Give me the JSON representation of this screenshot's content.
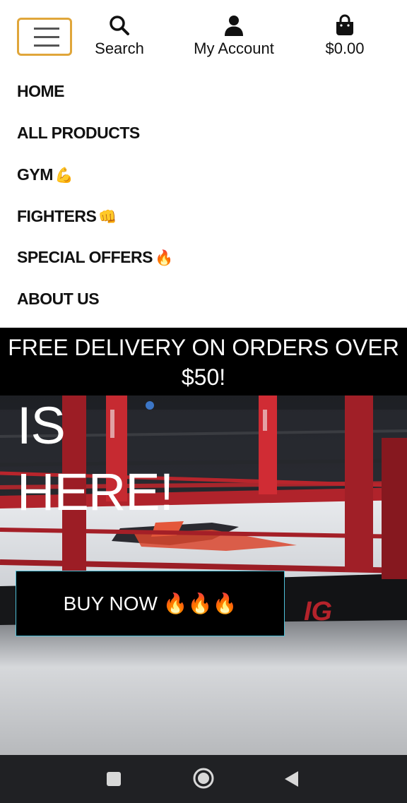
{
  "header": {
    "menu_icon": "hamburger-menu-icon",
    "search": {
      "label": "Search",
      "icon": "search-icon"
    },
    "account": {
      "label": "My Account",
      "icon": "user-icon"
    },
    "cart": {
      "label": "$0.00",
      "icon": "shopping-bag-icon"
    }
  },
  "nav": {
    "items": [
      {
        "label": "HOME",
        "emoji": ""
      },
      {
        "label": "ALL PRODUCTS",
        "emoji": ""
      },
      {
        "label": "GYM",
        "emoji": "💪"
      },
      {
        "label": "FIGHTERS",
        "emoji": "👊"
      },
      {
        "label": "SPECIAL OFFERS",
        "emoji": "🔥"
      },
      {
        "label": "ABOUT US",
        "emoji": ""
      }
    ]
  },
  "banner": {
    "text": "FREE DELIVERY ON ORDERS OVER $50!"
  },
  "hero": {
    "headline": "IS\nHERE!",
    "button_label": "BUY NOW 🔥🔥🔥"
  },
  "system_nav": {
    "buttons": [
      "recents-icon",
      "home-icon",
      "back-icon"
    ]
  },
  "colors": {
    "menu_border": "#e0a63a",
    "banner_bg": "#000000",
    "button_border": "#4ec0d8",
    "ring_rope": "#c8232c",
    "system_nav_bg": "#202124"
  }
}
